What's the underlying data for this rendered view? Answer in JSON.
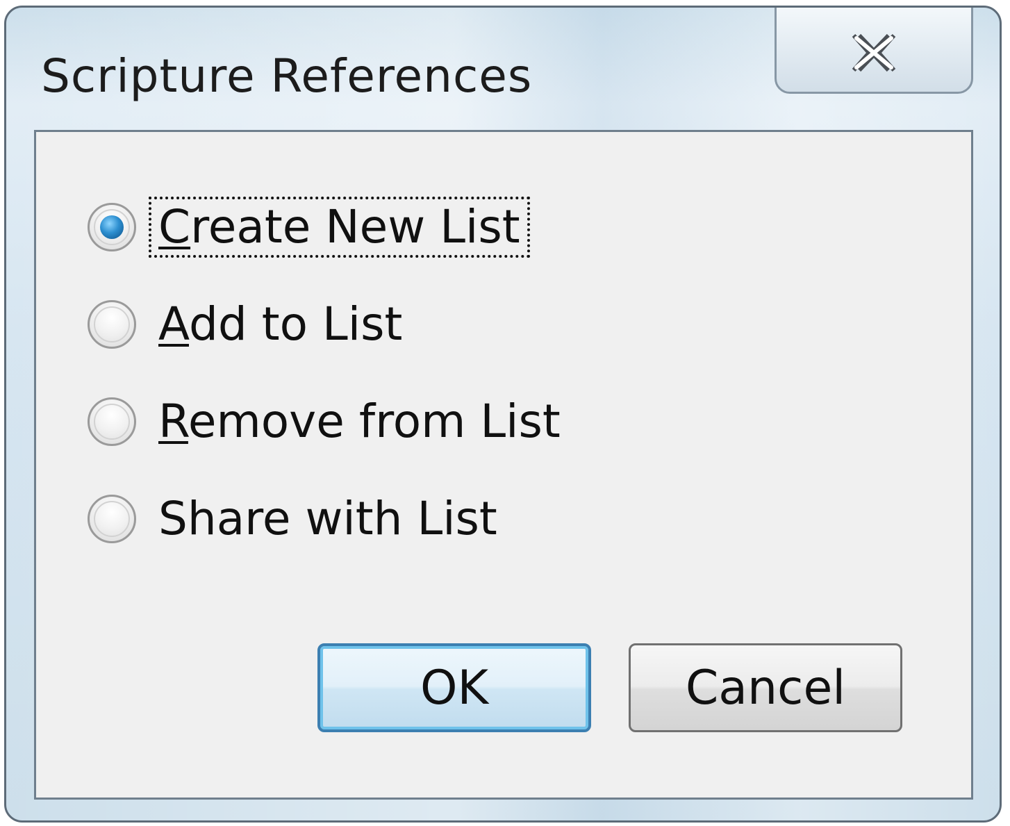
{
  "window": {
    "title": "Scripture References"
  },
  "options": [
    {
      "label": "Create New List",
      "mnemonic": "C",
      "rest": "reate New List",
      "checked": true,
      "focused": true
    },
    {
      "label": "Add to List",
      "mnemonic": "A",
      "rest": "dd to List",
      "checked": false,
      "focused": false
    },
    {
      "label": "Remove from List",
      "mnemonic": "R",
      "rest": "emove from List",
      "checked": false,
      "focused": false
    },
    {
      "label": "Share with List",
      "mnemonic": "",
      "rest": "Share with List",
      "checked": false,
      "focused": false
    }
  ],
  "buttons": {
    "ok_label": "OK",
    "cancel_label": "Cancel"
  },
  "icons": {
    "close": "close-icon",
    "radio_selected": "radio-selected-icon",
    "radio_unselected": "radio-unselected-icon"
  },
  "colors": {
    "accent": "#3c7fb1",
    "radio_dot": "#2d8fd0",
    "client_bg": "#f0f0f0"
  }
}
